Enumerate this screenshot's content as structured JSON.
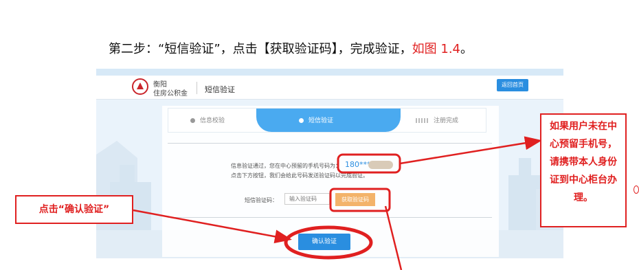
{
  "caption": {
    "text": "第二步：“短信验证”，点击【获取验证码】，完成验证，",
    "ref": "如图 1.4",
    "end": "。"
  },
  "header": {
    "org_line1": "衡阳",
    "org_line2": "住房公积金",
    "page_title": "短信验证",
    "home_button": "返回首页"
  },
  "steps": [
    {
      "label": "信息校验",
      "state": "done"
    },
    {
      "label": "短信验证",
      "state": "active"
    },
    {
      "label": "注册完成",
      "state": "pending"
    }
  ],
  "message": {
    "line1": "信息验证通过，您在中心预留的手机号码为：",
    "phone": "180****",
    "line2": "点击下方按钮，我们会给此号码发送验证码以完成验证。"
  },
  "sms_form": {
    "label": "短信验证码：",
    "placeholder": "输入验证码",
    "get_code_button": "获取验证码"
  },
  "confirm_button": "确认验证",
  "annotations": {
    "left_note": "点击“确认验证”",
    "right_note": "如果用户未在中心预留手机号，请携带本人身份证到中心柜台办理。"
  },
  "colors": {
    "accent_blue": "#2a8ee0",
    "step_active": "#4aaaf0",
    "button_orange": "#f3b36a",
    "annotation_red": "#e02020"
  }
}
